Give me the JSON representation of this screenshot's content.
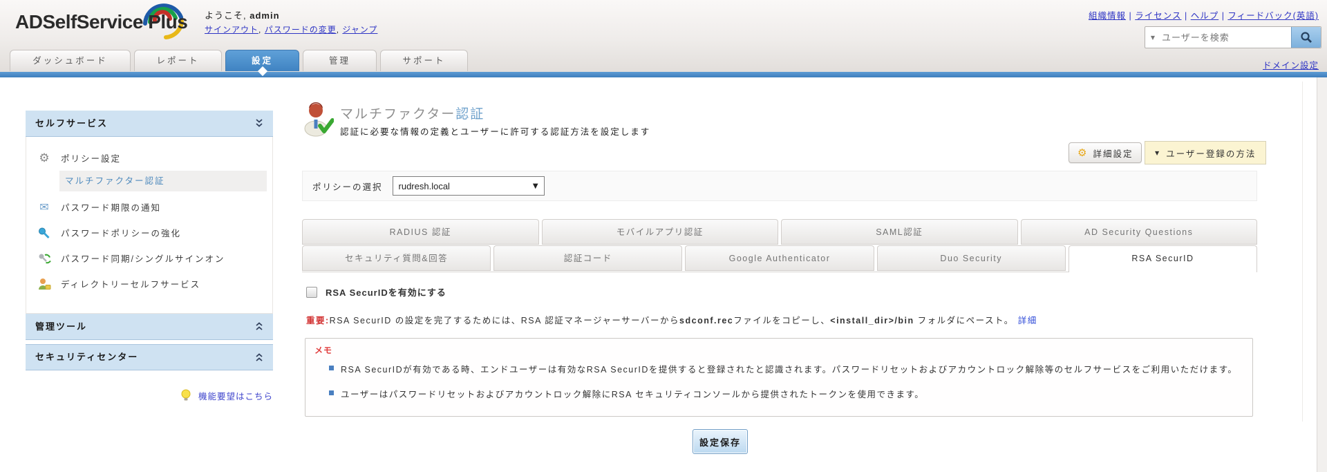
{
  "header": {
    "logo": "ADSelfService Plus",
    "welcome_prefix": "ようこそ,",
    "welcome_user": "admin",
    "welcome_links": [
      "サインアウト",
      "パスワードの変更",
      "ジャンプ"
    ],
    "link_separator": ", ",
    "top_links": [
      "組織情報",
      "ライセンス",
      "ヘルプ",
      "フィードバック(英語)"
    ],
    "top_link_separator": " | ",
    "search": {
      "placeholder": "ユーザーを検索",
      "caret_icon": "▼",
      "icon": "magnifier-icon"
    },
    "domain_settings": "ドメイン設定"
  },
  "nav": {
    "tabs": [
      {
        "label": "ダッシュボード",
        "active": false
      },
      {
        "label": "レポート",
        "active": false
      },
      {
        "label": "設定",
        "active": true
      },
      {
        "label": "管理",
        "active": false
      },
      {
        "label": "サポート",
        "active": false
      }
    ]
  },
  "sidebar": {
    "self_service_header": "セルフサービス",
    "items": [
      {
        "icon": "gear-icon",
        "label": "ポリシー設定"
      },
      {
        "icon": "mail-icon",
        "label": "パスワード期限の通知"
      },
      {
        "icon": "key-icon",
        "label": "パスワードポリシーの強化"
      },
      {
        "icon": "sync-keys-icon",
        "label": "パスワード同期/シングルサインオン"
      },
      {
        "icon": "user-icon",
        "label": "ディレクトリーセルフサービス"
      }
    ],
    "selected_subitem": "マルチファクター認証",
    "collapsed_sections": [
      "管理ツール",
      "セキュリティセンター"
    ],
    "feature_request": "機能要望はこちら"
  },
  "main": {
    "title_gray": "マルチファクター",
    "title_blue": "認証",
    "subtitle": "認証に必要な情報の定義とユーザーに許可する認証方法を設定します",
    "advanced_button": "詳細設定",
    "enroll_button": "ユーザー登録の方法",
    "enroll_caret": "▼",
    "policy": {
      "label": "ポリシーの選択",
      "selected": "rudresh.local",
      "caret": "▼"
    },
    "tabs_row1": [
      {
        "label": "RADIUS 認証",
        "active": false
      },
      {
        "label": "モバイルアプリ認証",
        "active": false
      },
      {
        "label": "SAML認証",
        "active": false
      },
      {
        "label": "AD Security Questions",
        "active": false
      }
    ],
    "tabs_row2": [
      {
        "label": "セキュリティ質問&回答",
        "active": false
      },
      {
        "label": "認証コード",
        "active": false
      },
      {
        "label": "Google Authenticator",
        "active": false
      },
      {
        "label": "Duo Security",
        "active": false
      },
      {
        "label": "RSA SecurID",
        "active": true
      }
    ],
    "rsa": {
      "enable_label": "RSA SecurIDを有効にする",
      "important": {
        "label": "重要:",
        "text1": "RSA SecurID の設定を完了するためには、RSA 認証マネージャーサーバーから",
        "file": "sdconf.rec",
        "text2": "ファイルをコピーし、",
        "path": "<install_dir>/bin",
        "text3": " フォルダにペースト。",
        "more_link": "詳細"
      },
      "note_title": "メモ",
      "notes": [
        "RSA SecurIDが有効である時、エンドユーザーは有効なRSA SecurIDを提供すると登録されたと認識されます。パスワードリセットおよびアカウントロック解除等のセルフサービスをご利用いただけます。",
        "ユーザーはパスワードリセットおよびアカウントロック解除にRSA セキュリティコンソールから提供されたトークンを使用できます。"
      ]
    },
    "save_button": "設定保存"
  },
  "colors": {
    "accent_blue": "#3f83c2",
    "light_blue_panel": "#cfe2f2",
    "link_blue": "#2e34c4",
    "alert_red": "#d23434",
    "enroll_yellow": "#fbf4d2"
  }
}
